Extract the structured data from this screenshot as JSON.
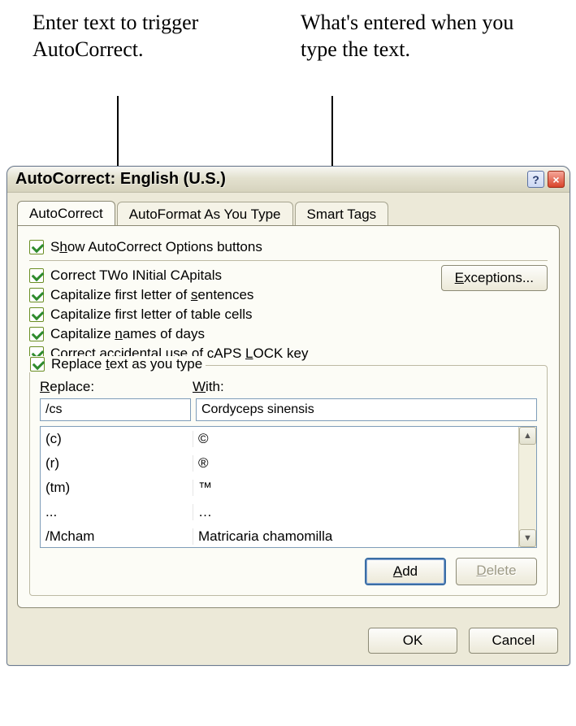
{
  "callouts": {
    "left": "Enter text to trigger AutoCorrect.",
    "right": "What's entered when you type the text."
  },
  "dialog": {
    "title": "AutoCorrect: English (U.S.)",
    "help_tip": "?",
    "close_tip": "×",
    "tabs": {
      "autocorrect": "AutoCorrect",
      "autoformat": "AutoFormat As You Type",
      "smarttags": "Smart Tags"
    },
    "checks": {
      "show_buttons_pre": "S",
      "show_buttons_ul": "h",
      "show_buttons_post": "ow AutoCorrect Options buttons",
      "two_caps": "Correct TWo INitial CApitals",
      "first_sentence_pre": "Capitalize first letter of ",
      "first_sentence_ul": "s",
      "first_sentence_post": "entences",
      "table_cells": "Capitalize first letter of table cells",
      "days_pre": "Capitalize ",
      "days_ul": "n",
      "days_post": "ames of days",
      "caps_lock_pre": "Correct accidental use of cAPS ",
      "caps_lock_ul": "L",
      "caps_lock_post": "OCK key",
      "replace_pre": "Replace ",
      "replace_ul": "t",
      "replace_post": "ext as you type"
    },
    "exceptions_btn_pre": "",
    "exceptions_btn_ul": "E",
    "exceptions_btn_post": "xceptions...",
    "labels": {
      "replace_ul": "R",
      "replace_post": "eplace:",
      "with_ul": "W",
      "with_post": "ith:"
    },
    "inputs": {
      "replace_value": "/cs",
      "with_value": "Cordyceps sinensis"
    },
    "list": [
      {
        "r": "(c)",
        "w": "©"
      },
      {
        "r": "(r)",
        "w": "®"
      },
      {
        "r": "(tm)",
        "w": "™"
      },
      {
        "r": "...",
        "w": "…"
      },
      {
        "r": "/Mcham",
        "w": "Matricaria chamomilla"
      }
    ],
    "buttons": {
      "add_ul": "A",
      "add_post": "dd",
      "delete_ul": "D",
      "delete_post": "elete",
      "ok": "OK",
      "cancel": "Cancel"
    }
  }
}
